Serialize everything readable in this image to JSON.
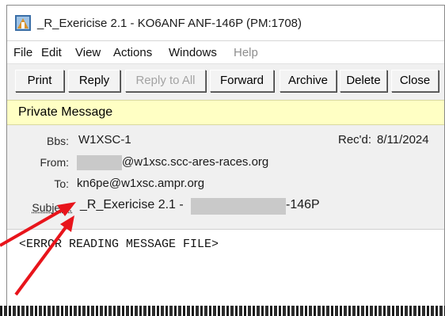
{
  "window": {
    "title": "_R_Exericise 2.1 - KO6ANF ANF-146P  (PM:1708)",
    "icon": "packet-radio-app-icon"
  },
  "menu": {
    "items": [
      "File",
      "Edit",
      "View",
      "Actions",
      "Windows",
      "Help"
    ],
    "disabled": [
      "Help"
    ]
  },
  "toolbar": {
    "print": "Print",
    "reply": "Reply",
    "reply_all": "Reply to All",
    "forward": "Forward",
    "archive": "Archive",
    "delete": "Delete",
    "close": "Close"
  },
  "banner": "Private Message",
  "header": {
    "bbs_label": "Bbs:",
    "bbs_value": "W1XSC-1",
    "recd_label": "Rec'd:",
    "recd_value": "8/11/2024",
    "from_label": "From:",
    "from_value": "@w1xsc.scc-ares-races.org",
    "to_label": "To:",
    "to_value": "kn6pe@w1xsc.ampr.org",
    "subject_label": "Subject:",
    "subject_part1": "_R_Exericise 2.1 -",
    "subject_part2": "-146P"
  },
  "body": {
    "text": "<ERROR READING MESSAGE FILE>"
  },
  "colors": {
    "banner_bg": "#ffffc4",
    "annotation_arrow": "#e8141b",
    "redaction": "#c9c9c9"
  }
}
